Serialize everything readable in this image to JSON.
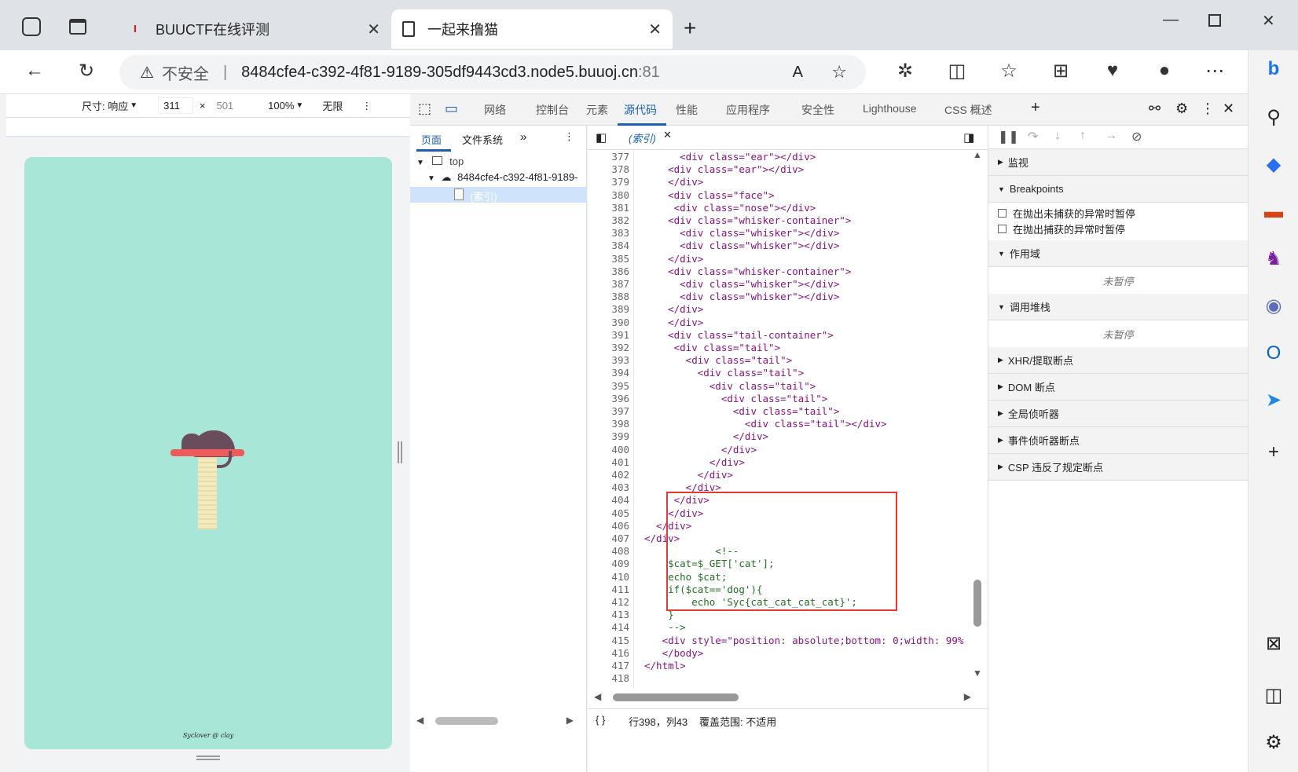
{
  "tabs": [
    {
      "label": "BUUCTF在线评测",
      "favicon": "buuctf"
    },
    {
      "label": "一起来撸猫"
    }
  ],
  "address": {
    "security": "不安全",
    "url": "8484cfe4-c392-4f81-9189-305df9443cd3.node5.buuoj.cn",
    "port": ":81"
  },
  "emulation": {
    "size_label": "尺寸: 响应",
    "width": "311",
    "height": "501",
    "zoom": "100%",
    "throttle": "无限",
    "x": "×"
  },
  "page_footer": "Syclover @ clay",
  "devtools_tabs": [
    "网络",
    "控制台",
    "元素",
    "源代码",
    "性能",
    "应用程序",
    "安全性",
    "Lighthouse",
    "CSS 概述"
  ],
  "nav": {
    "tab_page": "页面",
    "tab_fs": "文件系统",
    "tree": [
      "top",
      "8484cfe4-c392-4f81-9189-",
      "(索引)"
    ]
  },
  "editor": {
    "file_tab": "(索引)",
    "status_braces": "{ }",
    "status_pos": "行398，列43",
    "status_cov": "覆盖范围: 不适用",
    "lines": [
      {
        "n": "377",
        "t": "      <div class=\"ear\"></div>"
      },
      {
        "n": "378",
        "t": "    <div class=\"ear\"></div>"
      },
      {
        "n": "379",
        "t": "    </div>"
      },
      {
        "n": "380",
        "t": "    <div class=\"face\">"
      },
      {
        "n": "381",
        "t": "     <div class=\"nose\"></div>"
      },
      {
        "n": "382",
        "t": "    <div class=\"whisker-container\">"
      },
      {
        "n": "383",
        "t": "      <div class=\"whisker\"></div>"
      },
      {
        "n": "384",
        "t": "      <div class=\"whisker\"></div>"
      },
      {
        "n": "385",
        "t": "    </div>"
      },
      {
        "n": "386",
        "t": "    <div class=\"whisker-container\">"
      },
      {
        "n": "387",
        "t": "      <div class=\"whisker\"></div>"
      },
      {
        "n": "388",
        "t": "      <div class=\"whisker\"></div>"
      },
      {
        "n": "389",
        "t": "    </div>"
      },
      {
        "n": "390",
        "t": "    </div>"
      },
      {
        "n": "391",
        "t": "    <div class=\"tail-container\">"
      },
      {
        "n": "392",
        "t": "     <div class=\"tail\">"
      },
      {
        "n": "393",
        "t": "       <div class=\"tail\">"
      },
      {
        "n": "394",
        "t": "         <div class=\"tail\">"
      },
      {
        "n": "395",
        "t": "           <div class=\"tail\">"
      },
      {
        "n": "396",
        "t": "             <div class=\"tail\">"
      },
      {
        "n": "397",
        "t": "               <div class=\"tail\">"
      },
      {
        "n": "398",
        "t": "                 <div class=\"tail\"></div>"
      },
      {
        "n": "399",
        "t": "               </div>"
      },
      {
        "n": "400",
        "t": "             </div>"
      },
      {
        "n": "401",
        "t": "           </div>"
      },
      {
        "n": "402",
        "t": "         </div>"
      },
      {
        "n": "403",
        "t": "       </div>"
      },
      {
        "n": "404",
        "t": "     </div>"
      },
      {
        "n": "405",
        "t": "    </div>"
      },
      {
        "n": "406",
        "t": "  </div>"
      },
      {
        "n": "407",
        "t": "</div>"
      },
      {
        "n": "408",
        "t": "            <!--"
      },
      {
        "n": "409",
        "t": "    $cat=$_GET['cat'];"
      },
      {
        "n": "410",
        "t": "    echo $cat;"
      },
      {
        "n": "411",
        "t": "    if($cat=='dog'){"
      },
      {
        "n": "412",
        "t": "        echo 'Syc{cat_cat_cat_cat}';"
      },
      {
        "n": "413",
        "t": "    }"
      },
      {
        "n": "414",
        "t": "    -->"
      },
      {
        "n": "415",
        "t": "   <div style=\"position: absolute;bottom: 0;width: 99%"
      },
      {
        "n": "416",
        "t": "   </body>"
      },
      {
        "n": "417",
        "t": "</html>"
      },
      {
        "n": "418",
        "t": ""
      }
    ]
  },
  "debug": {
    "sections": [
      "监视",
      "Breakpoints",
      "作用域",
      "调用堆栈",
      "XHR/提取断点",
      "DOM 断点",
      "全局侦听器",
      "事件侦听器断点",
      "CSP 违反了规定断点"
    ],
    "cb1": "在抛出未捕获的异常时暂停",
    "cb2": "在抛出捕获的异常时暂停",
    "not_paused": "未暂停"
  },
  "colors": {
    "accent": "#1a5fb4",
    "highlight_box": "#e53935",
    "page_bg": "#a8e6d8"
  }
}
